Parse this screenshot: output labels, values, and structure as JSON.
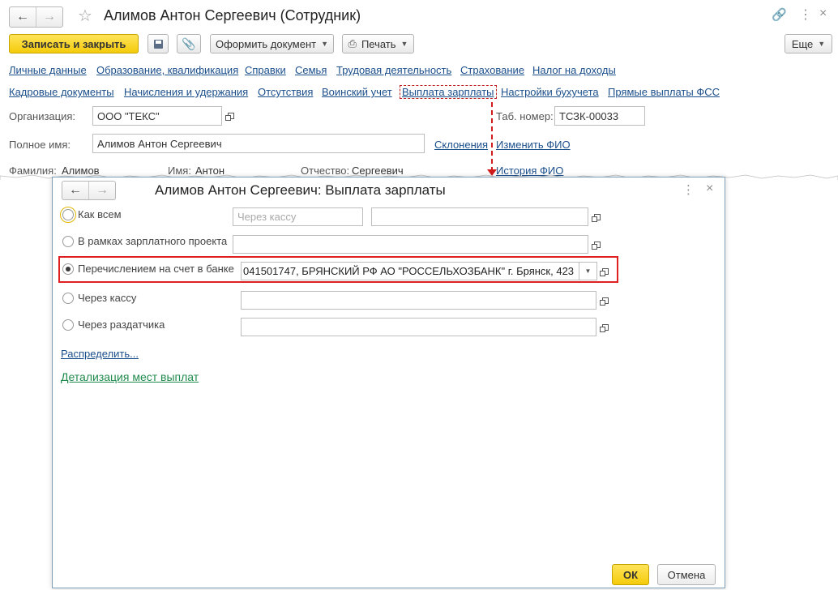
{
  "main": {
    "title": "Алимов Антон Сергеевич (Сотрудник)",
    "toolbar": {
      "save_close": "Записать и закрыть",
      "make_doc": "Оформить документ",
      "print": "Печать",
      "more": "Еще"
    },
    "links_row1": [
      "Личные данные",
      "Образование, квалификация",
      "Справки",
      "Семья",
      "Трудовая деятельность",
      "Страхование",
      "Налог на доходы"
    ],
    "links_row2": [
      "Кадровые документы",
      "Начисления и удержания",
      "Отсутствия",
      "Воинский учет",
      "Выплата зарплаты",
      "Настройки бухучета",
      "Прямые выплаты ФСС"
    ],
    "org_label": "Организация:",
    "org_value": "ООО \"ТЕКС\"",
    "tab_label": "Таб. номер:",
    "tab_value": "ТСЗК-00033",
    "fullname_label": "Полное имя:",
    "fullname_value": "Алимов Антон Сергеевич",
    "declension_link": "Склонения",
    "change_fio_link": "Изменить ФИО",
    "surname_label": "Фамилия:",
    "surname_value": "Алимов",
    "name_label": "Имя:",
    "name_value": "Антон",
    "patronymic_label": "Отчество:",
    "patronymic_value": "Сергеевич",
    "history_link": "История ФИО"
  },
  "dialog": {
    "title": "Алимов Антон Сергеевич: Выплата зарплаты",
    "options": [
      {
        "label": "Как всем",
        "selected": false
      },
      {
        "label": "В рамках зарплатного проекта",
        "selected": false
      },
      {
        "label": "Перечислением на счет в банке",
        "selected": true
      },
      {
        "label": "Через кассу",
        "selected": false
      },
      {
        "label": "Через раздатчика",
        "selected": false
      }
    ],
    "kassa_placeholder": "Через кассу",
    "bank_value": "041501747, БРЯНСКИЙ РФ АО \"РОССЕЛЬХОЗБАНК\" г. Брянск, 423",
    "distribute_link": "Распределить...",
    "detail_link": "Детализация мест выплат",
    "ok": "ОК",
    "cancel": "Отмена"
  },
  "colors": {
    "accent_yellow": "#f4cb0a",
    "link_blue": "#1b4f8c",
    "link_green": "#1f8a4c",
    "highlight_red": "#e02020"
  }
}
